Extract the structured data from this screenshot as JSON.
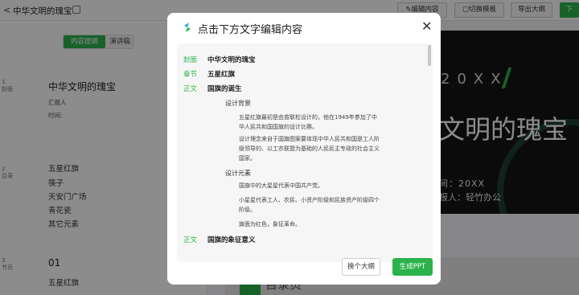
{
  "topbar": {
    "back_glyph": "<",
    "title": "中华文明的瑰宝",
    "edit_content": "编辑内容",
    "switch_template": "切换模板",
    "export_outline": "导出大纲",
    "download": "下"
  },
  "tabs": {
    "outline": "内容提纲",
    "speech": "演讲稿"
  },
  "outline": [
    {
      "num": "1",
      "label": "封面",
      "lines": [
        "中华文明的瑰宝",
        "汇报人",
        "时间:"
      ]
    },
    {
      "num": "2",
      "label": "目录",
      "lines": [
        "五星红旗",
        "筷子",
        "天安门广场",
        "青花瓷",
        "其它元素"
      ]
    },
    {
      "num": "3",
      "label": "节页",
      "lines": [
        "01",
        "五星红旗"
      ]
    }
  ],
  "slide": {
    "year": "20XX",
    "title": "文明的瑰宝",
    "time": "间：20XX",
    "reporter": "报人：轻竹办公",
    "bottom_text": "目录页"
  },
  "modal": {
    "title": "点击下方文字编辑内容",
    "close": "✕",
    "rows": [
      {
        "tag": "封面",
        "text": "中华文明的瑰宝"
      },
      {
        "tag": "章节",
        "text": "五星红旗"
      },
      {
        "tag": "正文",
        "text": "国旗的诞生"
      }
    ],
    "sec1": "设计背景",
    "p1": "五星红旗最初是由曾联松设计的，他在1949年参加了中华人民共和国国旗的设计比赛。",
    "p2": "设计理念来自于国旗图案要体现中华人民共和国是工人阶级领导的、以工农联盟为基础的人民民主专政的社会主义国家。",
    "sec2": "设计元素",
    "p3": "国旗中的大星星代表中国共产党。",
    "p4": "小星星代表工人、农民、小资产阶级和民族资产阶级四个阶级。",
    "p5": "旗面为红色，象征革命。",
    "row4": {
      "tag": "正文",
      "text": "国旗的象征意义"
    },
    "btn_change": "换个大纲",
    "btn_generate": "生成PPT"
  }
}
